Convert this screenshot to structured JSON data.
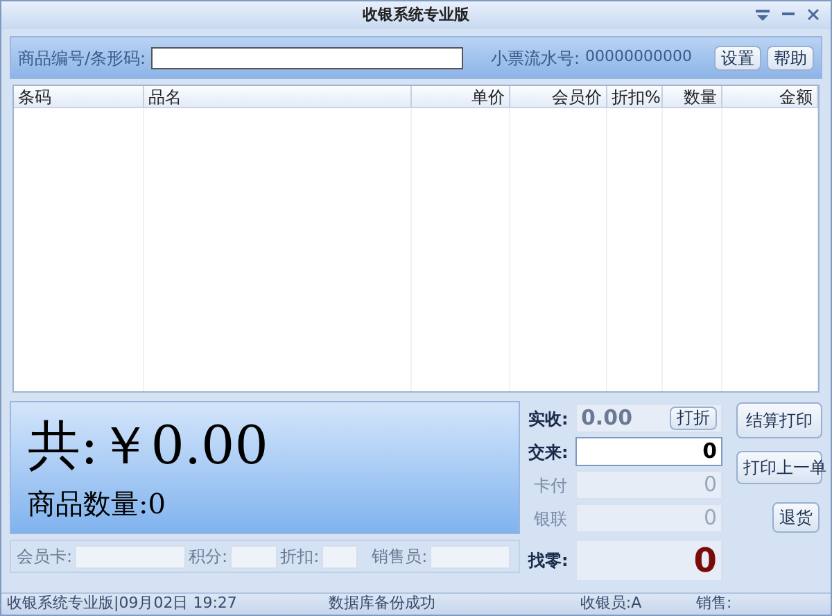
{
  "window": {
    "title": "收银系统专业版"
  },
  "search": {
    "label": "商品编号/条形码:",
    "receipt_label": "小票流水号:",
    "receipt_no": "00000000000",
    "buttons": [
      "设置",
      "帮助"
    ]
  },
  "table": {
    "columns": [
      {
        "label": "条码"
      },
      {
        "label": "品名"
      },
      {
        "label": "单价"
      },
      {
        "label": "会员价"
      },
      {
        "label": "折扣%"
      },
      {
        "label": "数量"
      },
      {
        "label": "金额"
      }
    ]
  },
  "total": {
    "amount": "共:￥0.00",
    "count": "商品数量:0"
  },
  "member": [
    {
      "label": "会员卡:"
    },
    {
      "label": "积分:"
    },
    {
      "label": "折扣:"
    },
    {
      "label": "销售员:"
    }
  ],
  "payment": [
    {
      "label": "实收:",
      "value": "0.00",
      "kind": "received",
      "button": "打折"
    },
    {
      "label": "交来:",
      "value": "0",
      "kind": "input"
    },
    {
      "label": "卡付",
      "value": "0",
      "kind": "disabled"
    },
    {
      "label": "银联",
      "value": "0",
      "kind": "disabled"
    },
    {
      "label": "找零:",
      "value": "0",
      "kind": "change"
    }
  ],
  "actions": [
    "结算打印",
    "打印上一单",
    "退货"
  ],
  "status_bar": [
    "收银系统专业版|09月02日 19:27",
    "数据库备份成功",
    "收银员:A",
    "销售:"
  ]
}
